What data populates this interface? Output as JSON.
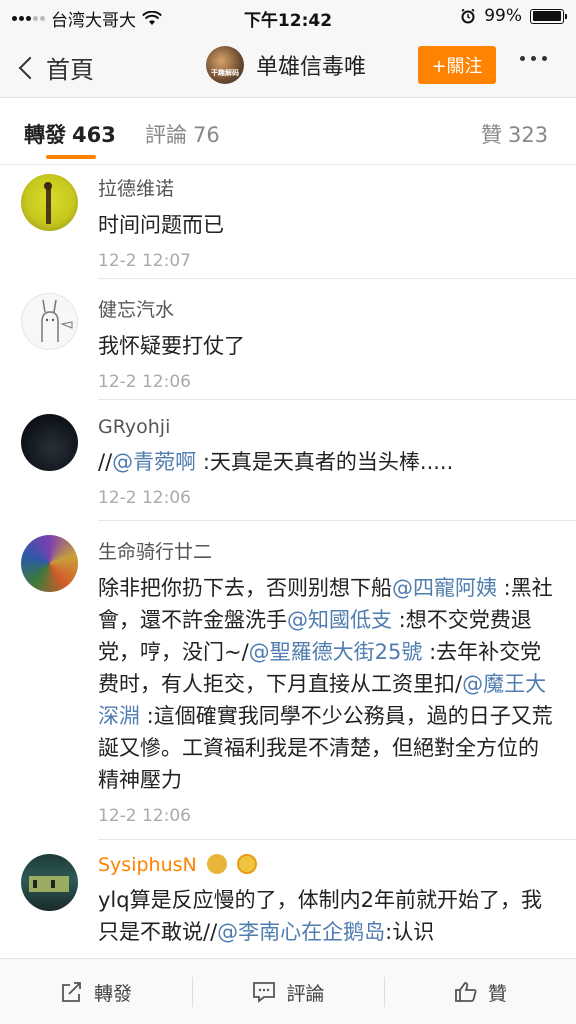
{
  "status_bar": {
    "carrier": "台湾大哥大",
    "time": "下午12:42",
    "battery": "99%",
    "battery_level": 0.99
  },
  "nav": {
    "back_label": "首頁",
    "user_name": "单雄信毒唯",
    "avatar_caption": "干趣解码",
    "follow_label": "+關注"
  },
  "tabs": [
    {
      "label": "轉發",
      "count": "463"
    },
    {
      "label": "評論",
      "count": "76"
    },
    {
      "label": "贊",
      "count": "323"
    }
  ],
  "comments": [
    {
      "user": "拉德维诺",
      "segments": [
        {
          "text": "时间问题而已",
          "mention": false
        }
      ],
      "time": "12-2 12:07"
    },
    {
      "user": "健忘汽水",
      "segments": [
        {
          "text": "我怀疑要打仗了",
          "mention": false
        }
      ],
      "time": "12-2 12:06"
    },
    {
      "user": "GRyohji",
      "segments": [
        {
          "text": "//",
          "mention": false
        },
        {
          "text": "@青菀啊",
          "mention": true
        },
        {
          "text": " :天真是天真者的当头棒.....",
          "mention": false
        }
      ],
      "time": "12-2 12:06"
    },
    {
      "user": "生命骑行廿二",
      "segments": [
        {
          "text": "除非把你扔下去，否则别想下船",
          "mention": false
        },
        {
          "text": "@四寵阿姨",
          "mention": true
        },
        {
          "text": " :黑社會，還不許金盤洗手",
          "mention": false
        },
        {
          "text": "@知國低支",
          "mention": true
        },
        {
          "text": " :想不交党费退党，哼，没门~/",
          "mention": false
        },
        {
          "text": "@聖羅德大街25號",
          "mention": true
        },
        {
          "text": " :去年补交党费时，有人拒交，下月直接从工资里扣/",
          "mention": false
        },
        {
          "text": "@魔王大深淵",
          "mention": true
        },
        {
          "text": " :這個確實我同學不少公務員，過的日子又荒誕又慘。工資福利我是不清楚，但絕對全方位的精神壓力",
          "mention": false
        }
      ],
      "time": "12-2 12:06"
    },
    {
      "user": "SysiphusN",
      "segments": [
        {
          "text": "ylq算是反应慢的了，体制内2年前就开始了，我只是不敢说//",
          "mention": false
        },
        {
          "text": "@李南心在企鹅岛",
          "mention": true
        },
        {
          "text": ":认识",
          "mention": false
        }
      ],
      "time": ""
    }
  ],
  "bottom_bar": {
    "repost_label": "轉發",
    "comment_label": "評論",
    "like_label": "贊"
  },
  "colors": {
    "accent": "#ff8200",
    "mention": "#507daf",
    "meta": "#aaaaaa"
  }
}
